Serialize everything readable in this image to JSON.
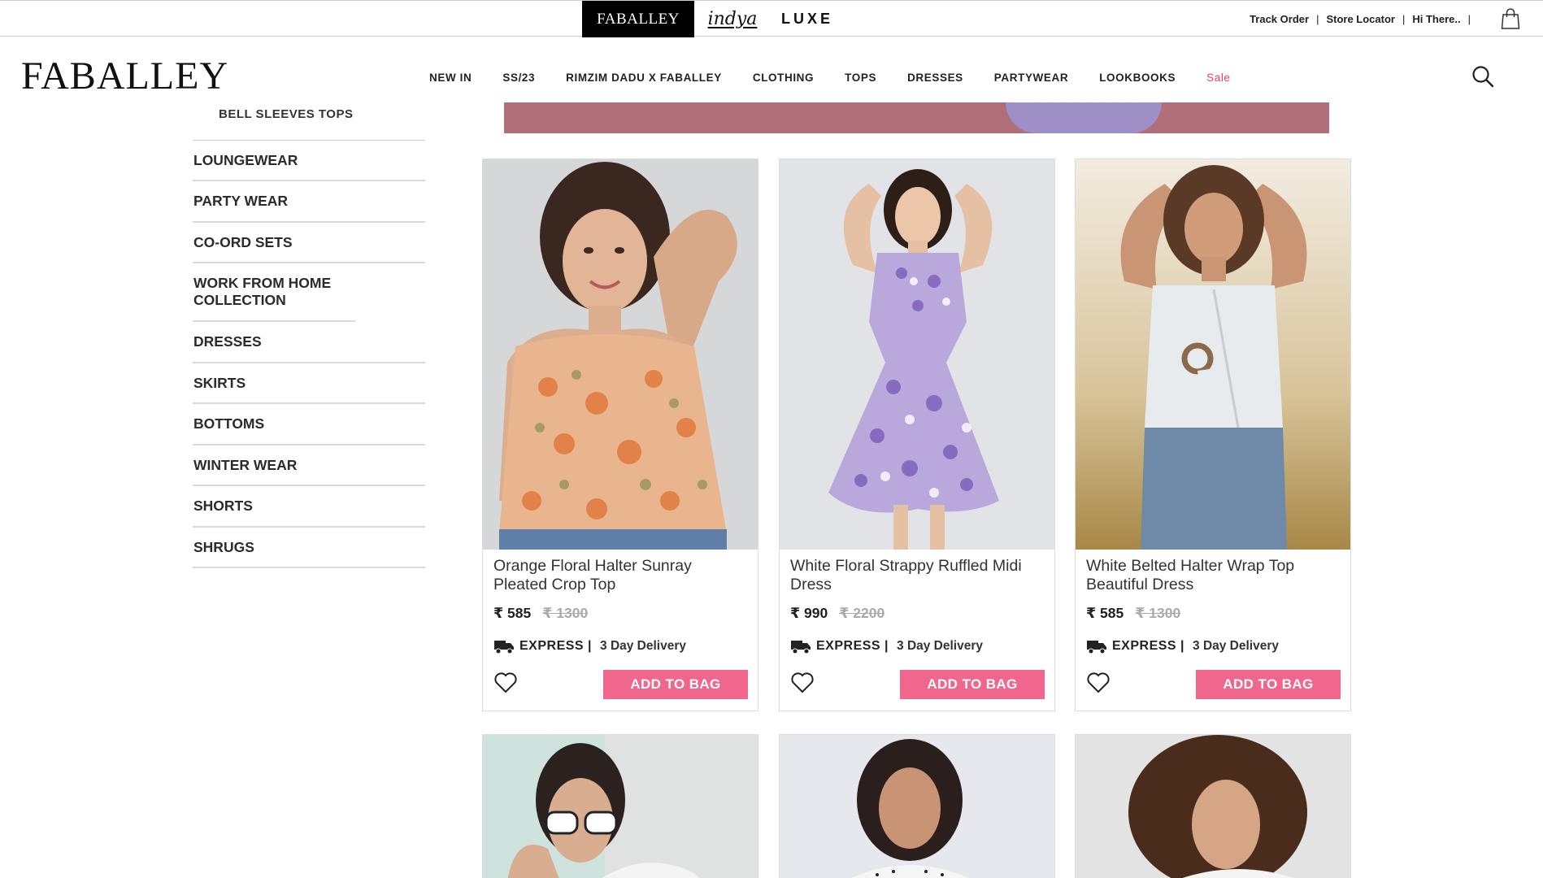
{
  "top_bar": {
    "brands": [
      "FABALLEY",
      "indya",
      "LUXE"
    ],
    "links": [
      "Track Order",
      "Store Locator",
      "Hi There.."
    ]
  },
  "header": {
    "logo": "FABALLEY",
    "nav": [
      "NEW IN",
      "SS/23",
      "RIMZIM DADU X FABALLEY",
      "CLOTHING",
      "TOPS",
      "DRESSES",
      "PARTYWEAR",
      "LOOKBOOKS",
      "Sale"
    ]
  },
  "sidebar": {
    "sub_item": "BELL SLEEVES TOPS",
    "items": [
      "LOUNGEWEAR",
      "PARTY WEAR",
      "CO-ORD SETS",
      "WORK FROM HOME COLLECTION",
      "DRESSES",
      "SKIRTS",
      "BOTTOMS",
      "WINTER WEAR",
      "SHORTS",
      "SHRUGS"
    ]
  },
  "products": [
    {
      "title": "Orange Floral Halter Sunray Pleated Crop Top",
      "price": "₹ 585",
      "mrp": "₹ 1300",
      "express": "EXPRESS |",
      "delivery": "3 Day Delivery",
      "cta": "ADD TO BAG"
    },
    {
      "title": "White Floral Strappy Ruffled Midi Dress",
      "price": "₹ 990",
      "mrp": "₹ 2200",
      "express": "EXPRESS |",
      "delivery": "3 Day Delivery",
      "cta": "ADD TO BAG"
    },
    {
      "title": "White Belted Halter Wrap Top Beautiful Dress",
      "price": "₹ 585",
      "mrp": "₹ 1300",
      "express": "EXPRESS |",
      "delivery": "3 Day Delivery",
      "cta": "ADD TO BAG"
    }
  ],
  "colors": {
    "accent_pink": "#f0668d",
    "sale_red": "#e8435d",
    "banner": "#b06e78"
  }
}
